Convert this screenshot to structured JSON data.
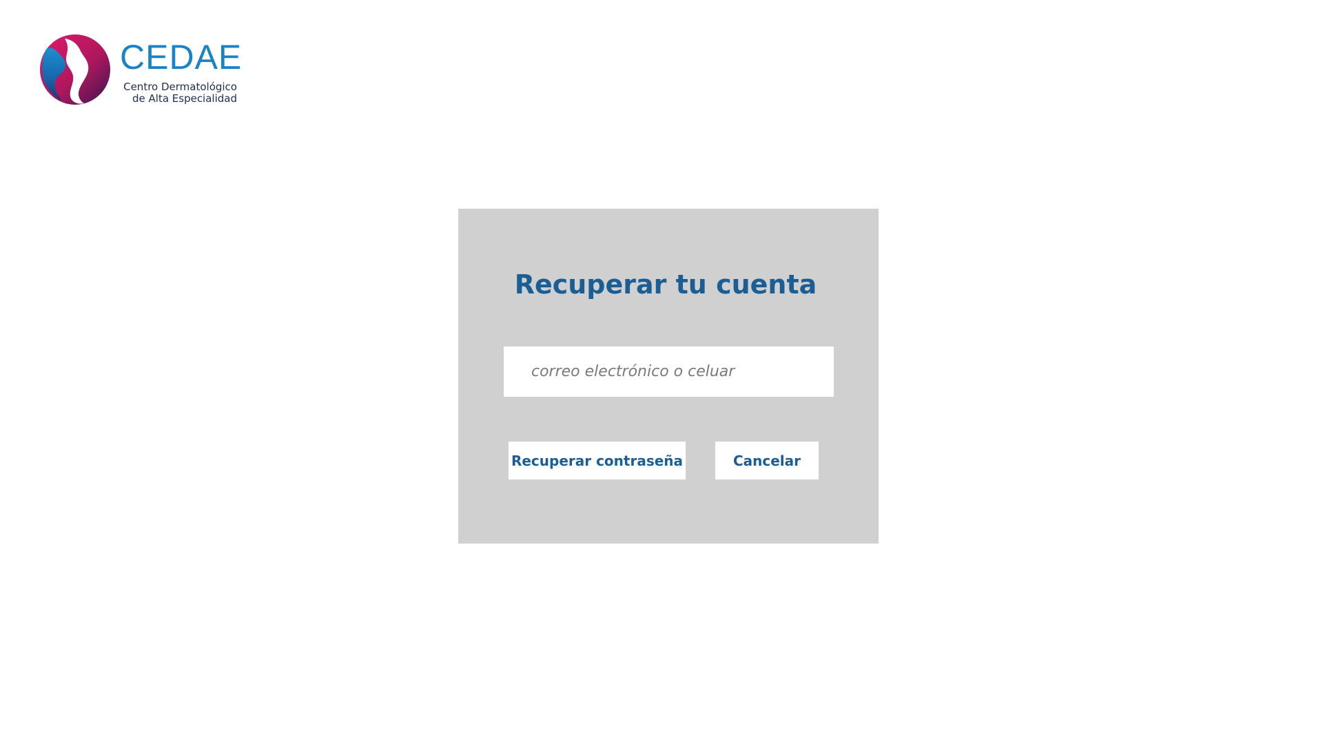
{
  "logo": {
    "wordmark": "CEDAE",
    "subtitle_line1": "Centro Dermatológico",
    "subtitle_line2": "de Alta Especialidad",
    "colors": {
      "wordmark": "#1a83c6",
      "subtitle": "#1d2d5c",
      "mark_magenta": "#d61f68",
      "mark_blue": "#1a7fc1",
      "mark_purple": "#4a1a5c"
    }
  },
  "recover_form": {
    "title": "Recuperar tu cuenta",
    "input": {
      "placeholder": "correo electrónico o celuar",
      "value": ""
    },
    "recover_button_label": "Recuperar contraseña",
    "cancel_button_label": "Cancelar"
  },
  "colors": {
    "card_background": "#d0d0d0",
    "accent": "#1a5e93",
    "page_background": "#ffffff"
  }
}
